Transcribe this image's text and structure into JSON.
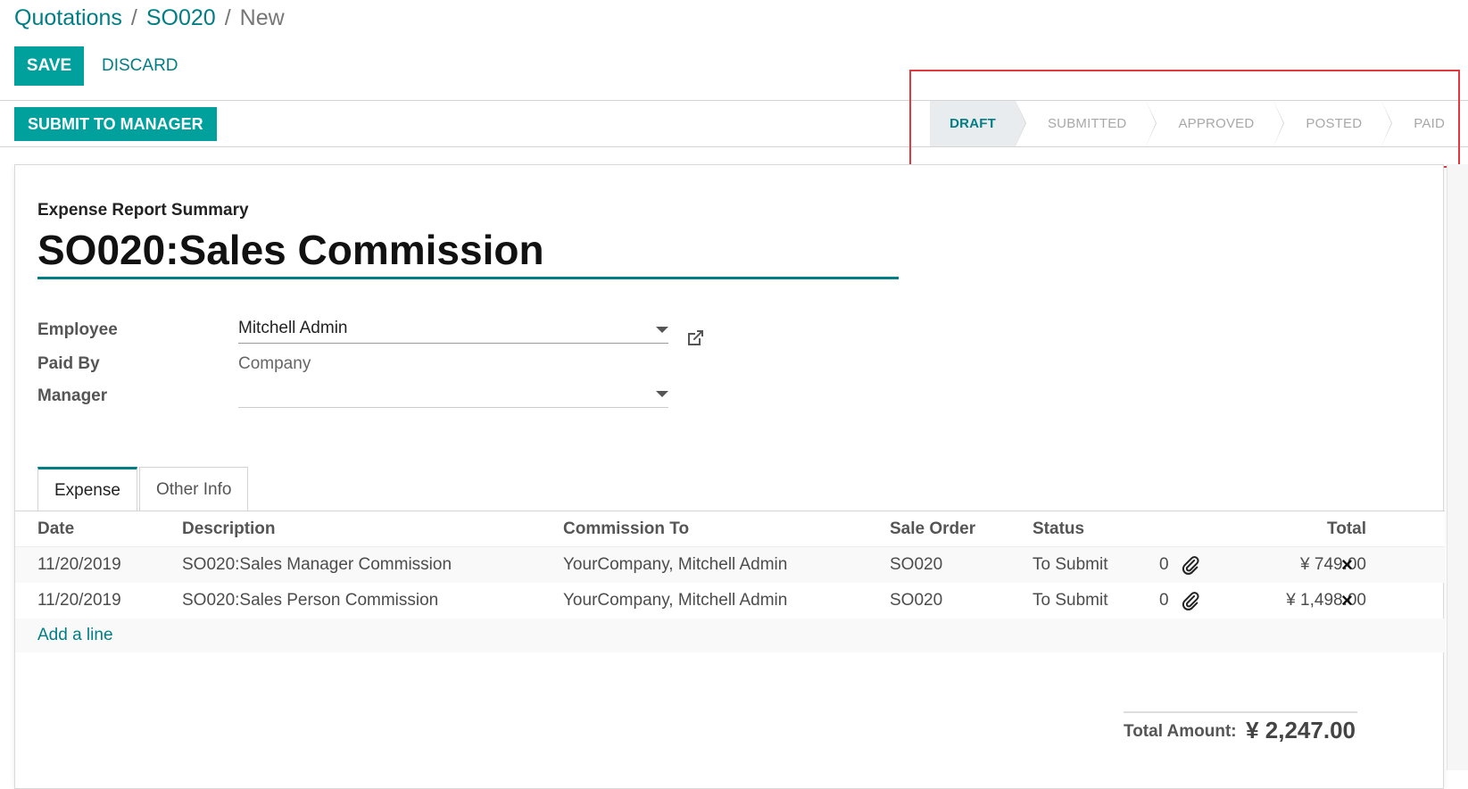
{
  "breadcrumb": {
    "items": [
      "Quotations",
      "SO020"
    ],
    "current": "New",
    "separator": "/"
  },
  "toolbar": {
    "save_label": "SAVE",
    "discard_label": "DISCARD"
  },
  "statusbar": {
    "submit_label": "SUBMIT TO MANAGER",
    "stages": [
      "DRAFT",
      "SUBMITTED",
      "APPROVED",
      "POSTED",
      "PAID"
    ],
    "active_stage": "DRAFT"
  },
  "form": {
    "summary_label": "Expense Report Summary",
    "title": "SO020:Sales Commission",
    "fields": {
      "employee": {
        "label": "Employee",
        "value": "Mitchell Admin"
      },
      "paid_by": {
        "label": "Paid By",
        "value": "Company"
      },
      "manager": {
        "label": "Manager",
        "value": ""
      }
    }
  },
  "tabs": [
    "Expense",
    "Other Info"
  ],
  "table": {
    "columns": [
      "Date",
      "Description",
      "Commission To",
      "Sale Order",
      "Status",
      "Total"
    ],
    "rows": [
      {
        "date": "11/20/2019",
        "description": "SO020:Sales Manager Commission",
        "commission_to": "YourCompany, Mitchell Admin",
        "sale_order": "SO020",
        "status": "To Submit",
        "attachments": "0",
        "total": "¥ 749.00"
      },
      {
        "date": "11/20/2019",
        "description": "SO020:Sales Person Commission",
        "commission_to": "YourCompany, Mitchell Admin",
        "sale_order": "SO020",
        "status": "To Submit",
        "attachments": "0",
        "total": "¥ 1,498.00"
      }
    ],
    "add_line_label": "Add a line",
    "delete_icon": "×"
  },
  "totals": {
    "label": "Total Amount:",
    "value": "¥ 2,247.00"
  },
  "colors": {
    "accent": "#017e84",
    "button": "#00a09d",
    "highlight": "#e0393e"
  }
}
